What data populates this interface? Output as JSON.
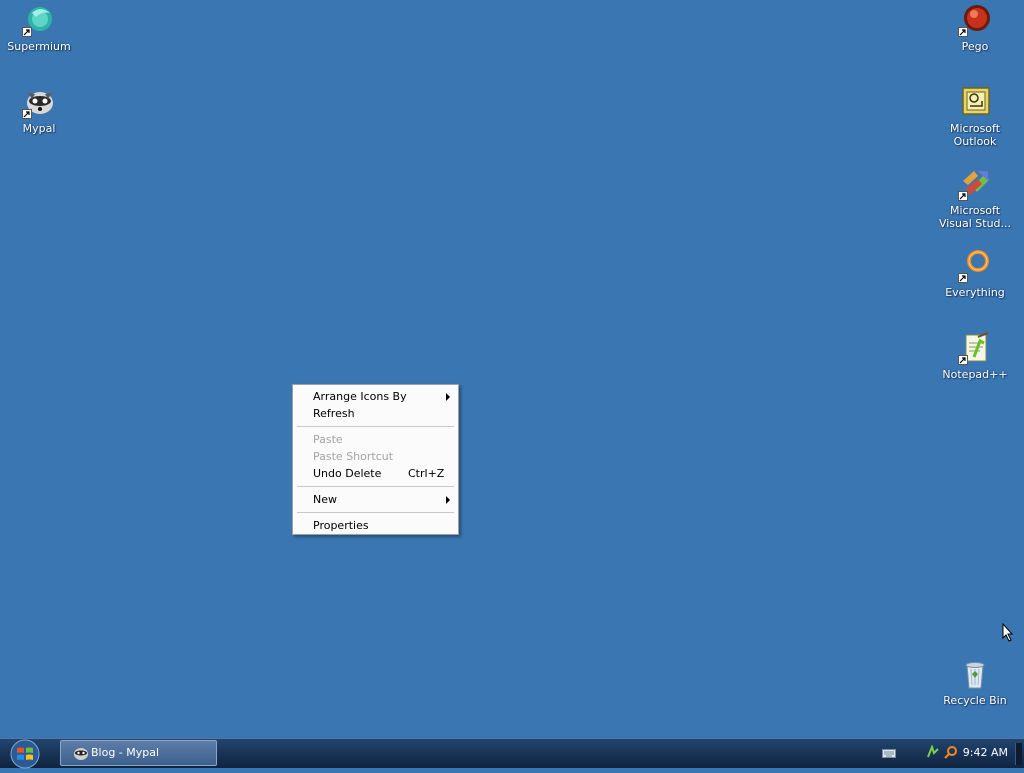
{
  "desktop": {
    "icons_left": [
      {
        "label": "Supermium",
        "icon": "supermium-icon"
      },
      {
        "label": "Mypal",
        "icon": "mypal-icon"
      }
    ],
    "icons_right": [
      {
        "label": "Pego",
        "icon": "pego-icon"
      },
      {
        "label": "Microsoft Outlook",
        "icon": "outlook-icon"
      },
      {
        "label": "Microsoft Visual Stud...",
        "icon": "visual-studio-icon"
      },
      {
        "label": "Everything",
        "icon": "everything-icon"
      },
      {
        "label": "Notepad++",
        "icon": "notepadpp-icon"
      },
      {
        "label": "Recycle Bin",
        "icon": "recycle-bin-icon"
      }
    ]
  },
  "context_menu": {
    "arrange": "Arrange Icons By",
    "refresh": "Refresh",
    "paste": "Paste",
    "paste_shortcut": "Paste Shortcut",
    "undo_delete": "Undo Delete",
    "undo_shortcut": "Ctrl+Z",
    "new": "New",
    "properties": "Properties"
  },
  "taskbar": {
    "window_button": "Blog - Mypal",
    "clock": "9:42 AM"
  },
  "colors": {
    "desktop": "#3a76b2",
    "taskbar": "#1a3558"
  }
}
